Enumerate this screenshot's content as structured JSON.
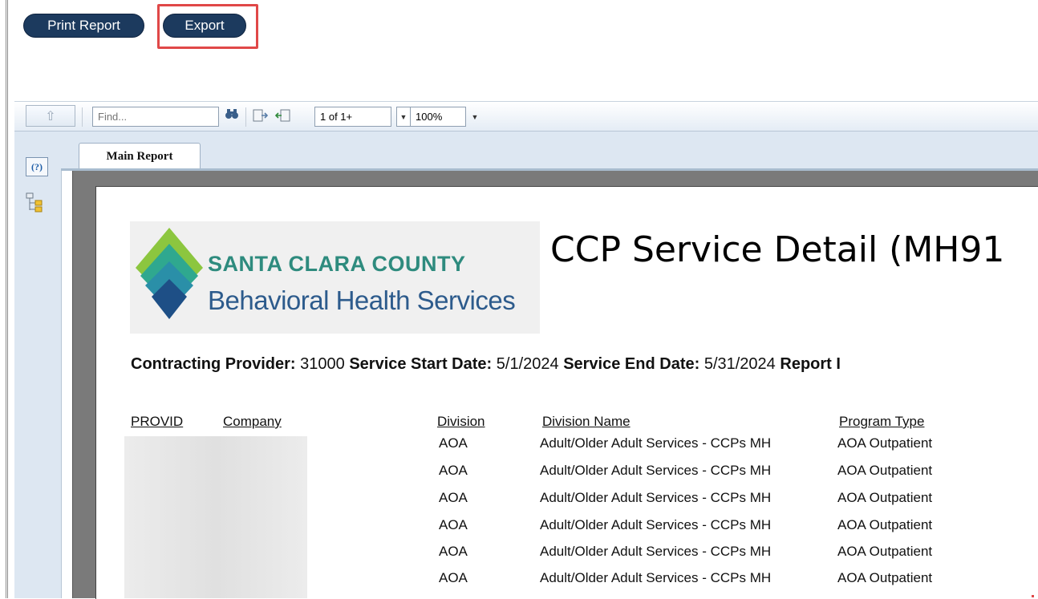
{
  "actions": {
    "print_label": "Print Report",
    "export_label": "Export"
  },
  "toolbar": {
    "find_placeholder": "Find...",
    "page_value": "1 of 1+",
    "zoom_value": "100%"
  },
  "sidebar": {
    "help_label": "(?)"
  },
  "tabs": [
    {
      "label": "Main Report"
    }
  ],
  "report": {
    "logo_line1": "SANTA CLARA COUNTY",
    "logo_line2": "Behavioral Health Services",
    "title": "CCP Service Detail (MH91",
    "criteria": {
      "contracting_provider_label": "Contracting Provider:",
      "contracting_provider_value": "31000",
      "start_label": "Service Start Date:",
      "start_value": "5/1/2024",
      "end_label": "Service End Date:",
      "end_value": "5/31/2024",
      "report_label": "Report I"
    },
    "columns": [
      "PROVID",
      "Company",
      "Division",
      "Division Name",
      "Program Type"
    ],
    "rows": [
      {
        "division": "AOA",
        "division_name": "Adult/Older Adult Services - CCPs MH",
        "program_type": "AOA Outpatient"
      },
      {
        "division": "AOA",
        "division_name": "Adult/Older Adult Services - CCPs MH",
        "program_type": "AOA Outpatient"
      },
      {
        "division": "AOA",
        "division_name": "Adult/Older Adult Services - CCPs MH",
        "program_type": "AOA Outpatient"
      },
      {
        "division": "AOA",
        "division_name": "Adult/Older Adult Services - CCPs MH",
        "program_type": "AOA Outpatient"
      },
      {
        "division": "AOA",
        "division_name": "Adult/Older Adult Services - CCPs MH",
        "program_type": "AOA Outpatient"
      },
      {
        "division": "AOA",
        "division_name": "Adult/Older Adult Services - CCPs MH",
        "program_type": "AOA Outpatient"
      }
    ]
  },
  "colors": {
    "button_bg": "#1c3a5e",
    "highlight": "#e04848",
    "panel_bg": "#dde7f2"
  }
}
